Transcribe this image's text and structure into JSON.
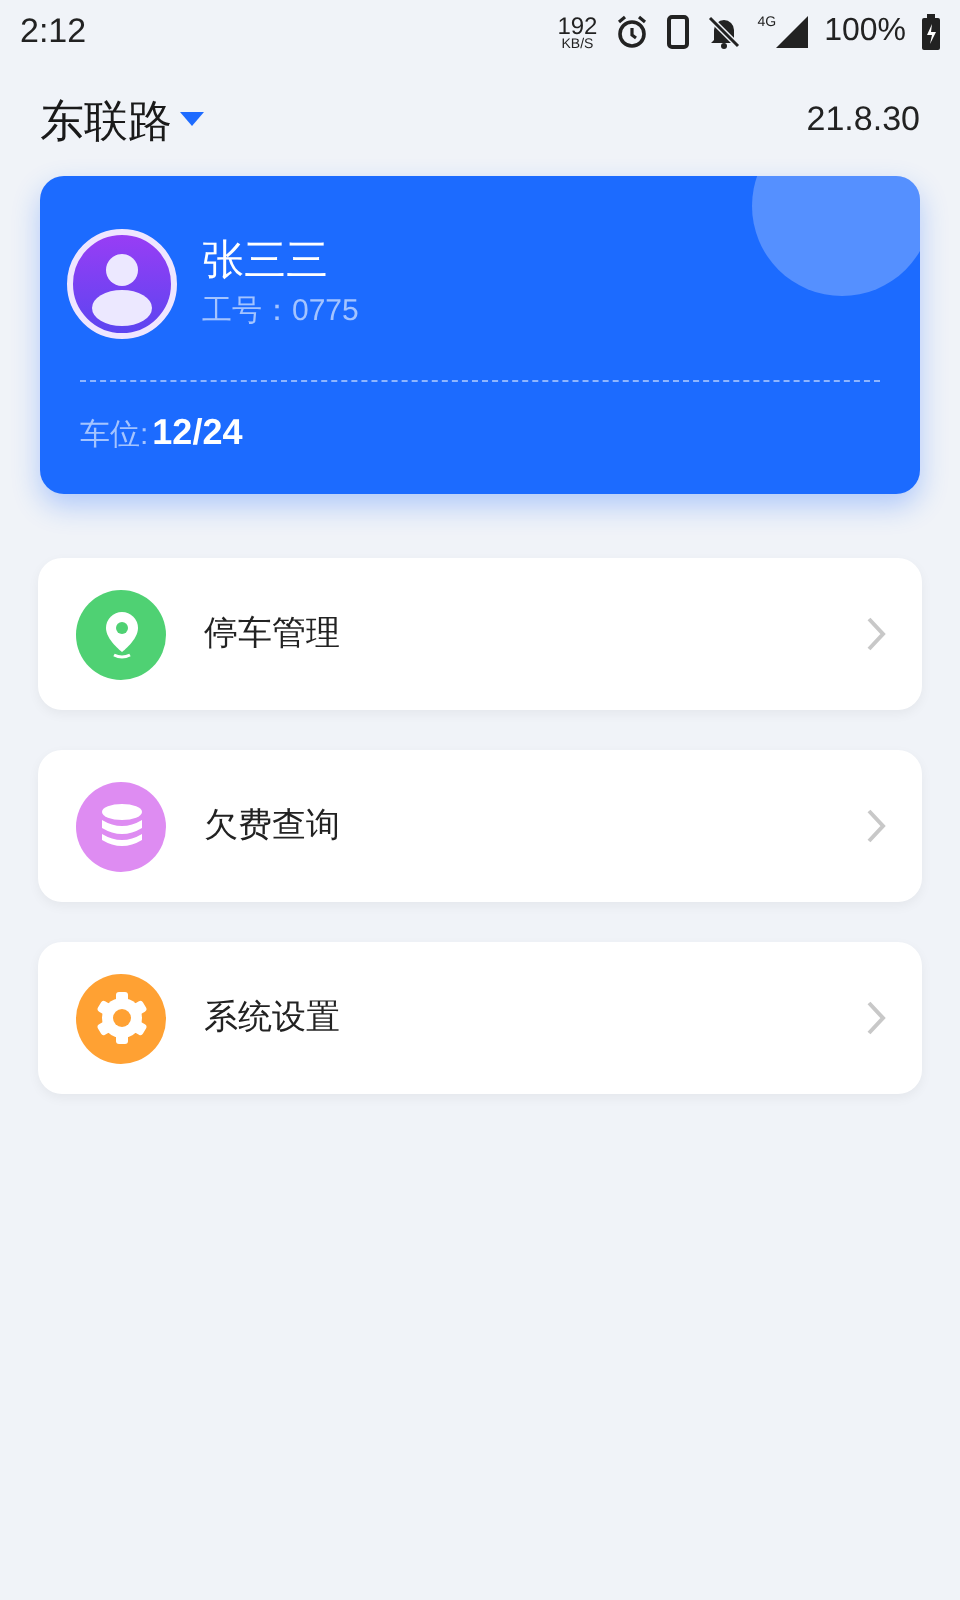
{
  "status_bar": {
    "time": "2:12",
    "speed": "192",
    "speed_unit": "KB/S",
    "network": "4G",
    "battery": "100%"
  },
  "header": {
    "location": "东联路",
    "date": "21.8.30"
  },
  "profile_card": {
    "name": "张三三",
    "employee_id": "工号：0775",
    "spaces_label": "车位:",
    "spaces_value": "12/24"
  },
  "menu": [
    {
      "label": "停车管理",
      "kind": "pin",
      "color": "#4fd173"
    },
    {
      "label": "欠费查询",
      "kind": "coins",
      "color": "#de8cf2"
    },
    {
      "label": "系统设置",
      "kind": "gear",
      "color": "#ffa133"
    }
  ]
}
